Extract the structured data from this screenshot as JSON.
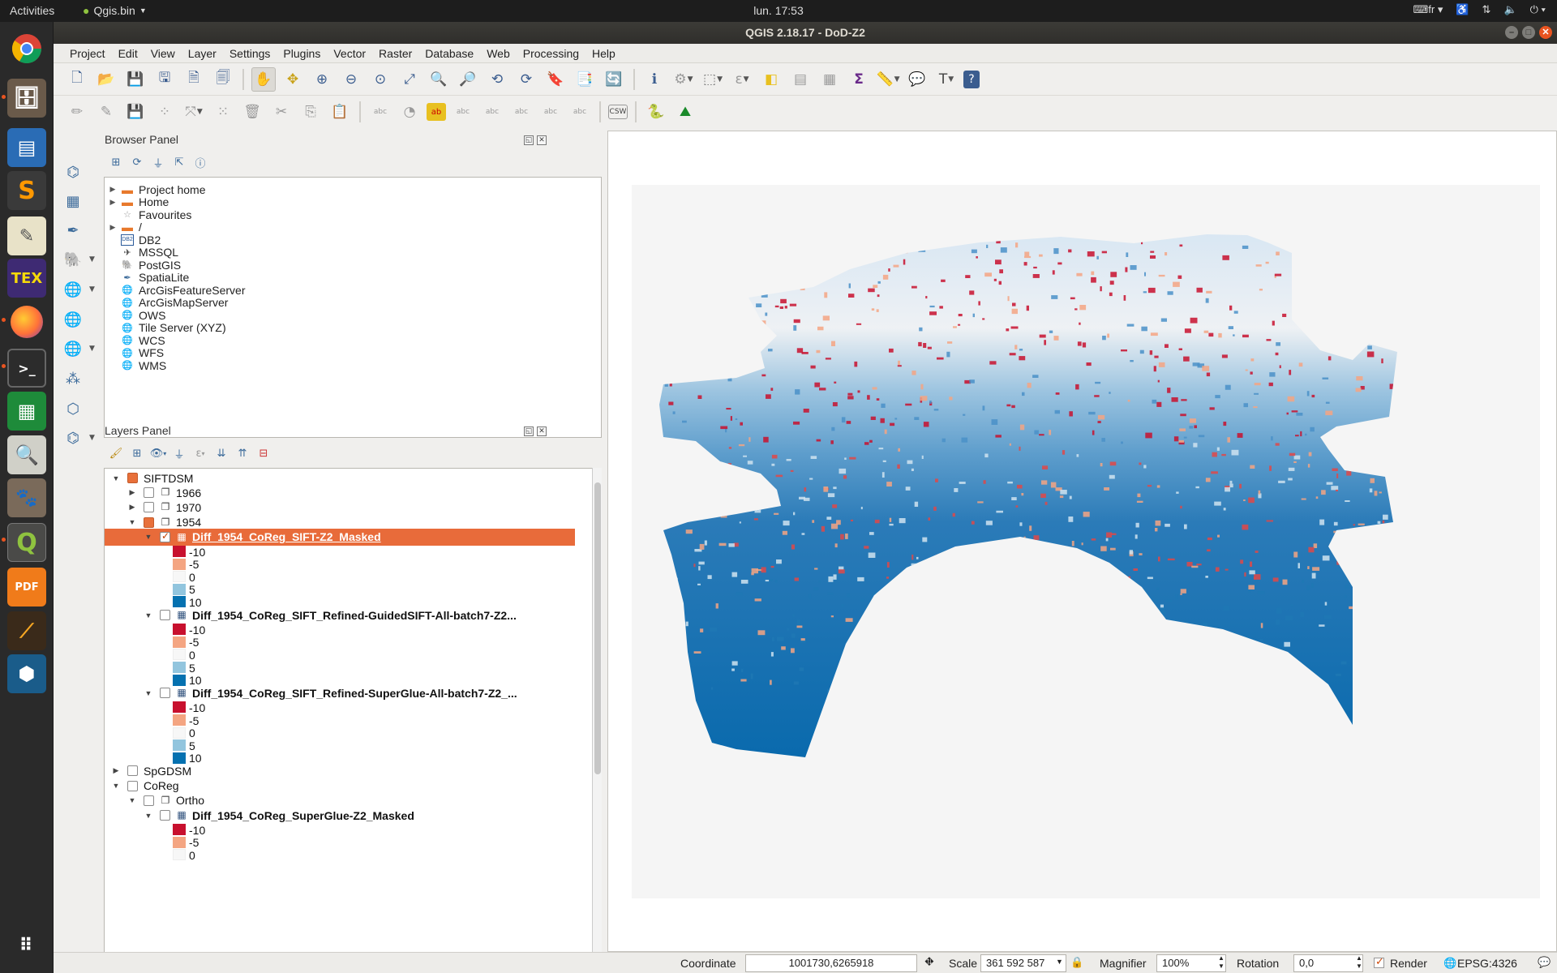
{
  "topbar": {
    "activities": "Activities",
    "app_name": "Qgis.bin",
    "clock": "lun. 17:53",
    "keyboard_layout": "fr"
  },
  "window": {
    "title": "QGIS 2.18.17 - DoD-Z2"
  },
  "menu": [
    "Project",
    "Edit",
    "View",
    "Layer",
    "Settings",
    "Plugins",
    "Vector",
    "Raster",
    "Database",
    "Web",
    "Processing",
    "Help"
  ],
  "browser_panel": {
    "title": "Browser Panel",
    "items": [
      {
        "label": "Project home",
        "icon": "folder-icon",
        "expandable": true
      },
      {
        "label": "Home",
        "icon": "folder-icon",
        "expandable": true
      },
      {
        "label": "Favourites",
        "icon": "star-icon",
        "expandable": false
      },
      {
        "label": "/",
        "icon": "folder-icon",
        "expandable": true
      },
      {
        "label": "DB2",
        "icon": "db2-icon",
        "expandable": false
      },
      {
        "label": "MSSQL",
        "icon": "mssql-icon",
        "expandable": false
      },
      {
        "label": "PostGIS",
        "icon": "postgis-icon",
        "expandable": false
      },
      {
        "label": "SpatiaLite",
        "icon": "spatialite-icon",
        "expandable": false
      },
      {
        "label": "ArcGisFeatureServer",
        "icon": "globe-icon",
        "expandable": false
      },
      {
        "label": "ArcGisMapServer",
        "icon": "globe-icon",
        "expandable": false
      },
      {
        "label": "OWS",
        "icon": "globe-icon",
        "expandable": false
      },
      {
        "label": "Tile Server (XYZ)",
        "icon": "globe-icon",
        "expandable": false
      },
      {
        "label": "WCS",
        "icon": "globe-icon",
        "expandable": false
      },
      {
        "label": "WFS",
        "icon": "globe-icon",
        "expandable": false
      },
      {
        "label": "WMS",
        "icon": "globe-icon",
        "expandable": false
      }
    ]
  },
  "layers_panel": {
    "title": "Layers Panel",
    "legend_colors": {
      "-10": "#c8102e",
      "-5": "#f4a582",
      "0": "#f7f7f7",
      "5": "#92c5de",
      "10": "#0571b0"
    },
    "rows": [
      {
        "kind": "group",
        "label": "SIFTDSM",
        "depth": 0,
        "expanded": true,
        "check": "partial"
      },
      {
        "kind": "group",
        "label": "1966",
        "depth": 1,
        "expanded": false,
        "check": "none"
      },
      {
        "kind": "group",
        "label": "1970",
        "depth": 1,
        "expanded": false,
        "check": "none"
      },
      {
        "kind": "group",
        "label": "1954",
        "depth": 1,
        "expanded": true,
        "check": "partial"
      },
      {
        "kind": "layer",
        "label": "Diff_1954_CoReg_SIFT-Z2_Masked",
        "depth": 2,
        "check": "checked",
        "selected": true
      },
      {
        "kind": "legend",
        "label": "-10",
        "depth": 3
      },
      {
        "kind": "legend",
        "label": "-5",
        "depth": 3
      },
      {
        "kind": "legend",
        "label": "0",
        "depth": 3
      },
      {
        "kind": "legend",
        "label": "5",
        "depth": 3
      },
      {
        "kind": "legend",
        "label": "10",
        "depth": 3
      },
      {
        "kind": "layer",
        "label": "Diff_1954_CoReg_SIFT_Refined-GuidedSIFT-All-batch7-Z2...",
        "depth": 2,
        "check": "none"
      },
      {
        "kind": "legend",
        "label": "-10",
        "depth": 3
      },
      {
        "kind": "legend",
        "label": "-5",
        "depth": 3
      },
      {
        "kind": "legend",
        "label": "0",
        "depth": 3
      },
      {
        "kind": "legend",
        "label": "5",
        "depth": 3
      },
      {
        "kind": "legend",
        "label": "10",
        "depth": 3
      },
      {
        "kind": "layer",
        "label": "Diff_1954_CoReg_SIFT_Refined-SuperGlue-All-batch7-Z2_...",
        "depth": 2,
        "check": "none"
      },
      {
        "kind": "legend",
        "label": "-10",
        "depth": 3
      },
      {
        "kind": "legend",
        "label": "-5",
        "depth": 3
      },
      {
        "kind": "legend",
        "label": "0",
        "depth": 3
      },
      {
        "kind": "legend",
        "label": "5",
        "depth": 3
      },
      {
        "kind": "legend",
        "label": "10",
        "depth": 3
      },
      {
        "kind": "group",
        "label": "SpGDSM",
        "depth": 0,
        "expanded": false,
        "check": "none"
      },
      {
        "kind": "group",
        "label": "CoReg",
        "depth": 0,
        "expanded": true,
        "check": "none"
      },
      {
        "kind": "group",
        "label": "Ortho",
        "depth": 1,
        "expanded": true,
        "check": "none"
      },
      {
        "kind": "layer",
        "label": "Diff_1954_CoReg_SuperGlue-Z2_Masked",
        "depth": 2,
        "check": "none"
      },
      {
        "kind": "legend",
        "label": "-10",
        "depth": 3
      },
      {
        "kind": "legend",
        "label": "-5",
        "depth": 3
      },
      {
        "kind": "legend",
        "label": "0",
        "depth": 3
      }
    ]
  },
  "statusbar": {
    "coordinate_label": "Coordinate",
    "coordinate_value": "1001730,6265918",
    "scale_label": "Scale",
    "scale_value": "361 592 587",
    "magnifier_label": "Magnifier",
    "magnifier_value": "100%",
    "rotation_label": "Rotation",
    "rotation_value": "0,0",
    "render_label": "Render",
    "crs": "EPSG:4326"
  }
}
